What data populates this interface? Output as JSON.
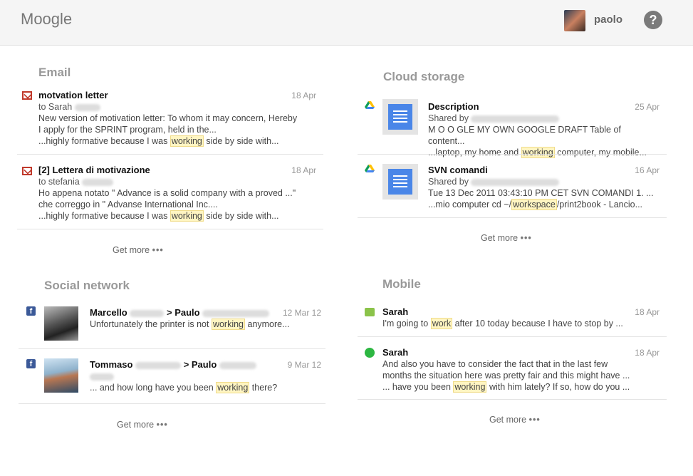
{
  "header": {
    "logo": "Moogle",
    "username": "paolo",
    "help_icon": "?"
  },
  "email": {
    "title": "Email",
    "items": [
      {
        "icon": "gmail-icon",
        "title": "motvation letter",
        "date": "18 Apr",
        "to": "to Sarah",
        "line1": "New version of motivation letter: To whom it may concern, Hereby",
        "line2": "I apply for the SPRINT program, held in the...",
        "snip_pre": "...highly formative because I was ",
        "snip_hl": "working",
        "snip_post": " side by side with..."
      },
      {
        "icon": "gmail-icon",
        "title": "[2] Lettera di motivazione",
        "date": "18 Apr",
        "to": "to stefania",
        "line1": "Ho appena notato \" Advance is a solid company with a proved ...\"",
        "line2": "che correggo in \" Advanse International Inc....",
        "snip_pre": "...highly formative because I was ",
        "snip_hl": "working",
        "snip_post": " side by side with..."
      }
    ],
    "get_more": "Get more",
    "dots": "•••"
  },
  "cloud": {
    "title": "Cloud storage",
    "items": [
      {
        "icon": "drive-icon",
        "title": "Description",
        "date": "25 Apr",
        "shared": "Shared by",
        "line1": "M O O GLE MY OWN GOOGLE DRAFT Table of content...",
        "snip_pre": "...laptop, my home and ",
        "snip_hl": "working",
        "snip_post": " computer, my mobile..."
      },
      {
        "icon": "drive-icon",
        "title": "SVN comandi",
        "date": "16 Apr",
        "shared": "Shared by",
        "line1": "Tue 13 Dec 2011 03:43:10 PM CET SVN COMANDI 1. ...",
        "snip_pre": "...mio computer cd ~/",
        "snip_hl": "workspace",
        "snip_post": "/print2book - Lancio..."
      }
    ],
    "get_more": "Get more",
    "dots": "•••"
  },
  "social": {
    "title": "Social network",
    "items": [
      {
        "icon": "facebook-icon",
        "from": "Marcello",
        "arrow": "> Paulo",
        "date": "12 Mar 12",
        "snip_pre": "Unfortunately the printer is not ",
        "snip_hl": "working",
        "snip_post": " anymore..."
      },
      {
        "icon": "facebook-icon",
        "from": "Tommaso",
        "arrow": "> Paulo",
        "date": "9 Mar 12",
        "snip_pre": "... and how long have you been ",
        "snip_hl": "working",
        "snip_post": " there?"
      }
    ],
    "get_more": "Get more",
    "dots": "•••"
  },
  "mobile": {
    "title": "Mobile",
    "items": [
      {
        "icon": "sms-icon",
        "title": "Sarah",
        "date": "18 Apr",
        "snip_pre": "I'm going to ",
        "snip_hl": "work",
        "snip_post": " after 10 today because I have to stop by ..."
      },
      {
        "icon": "whatsapp-icon",
        "title": "Sarah",
        "date": "18 Apr",
        "line1": "And also you have to consider the fact that in the last few",
        "line2": "months the situation here was pretty fair and this might have ...",
        "snip_pre": "... have you been ",
        "snip_hl": "working",
        "snip_post": " with him lately? If so, how do you ..."
      }
    ],
    "get_more": "Get more",
    "dots": "•••"
  }
}
